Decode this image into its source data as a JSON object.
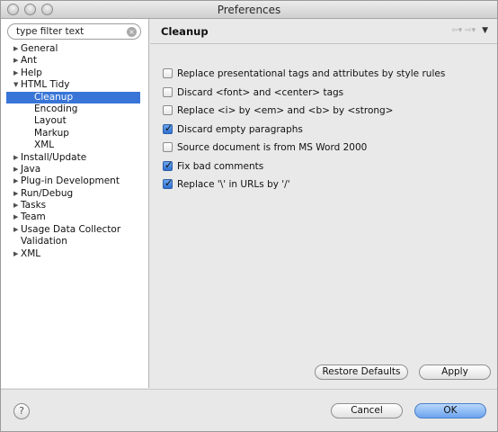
{
  "window": {
    "title": "Preferences"
  },
  "search": {
    "value": "type filter text"
  },
  "tree": [
    {
      "label": "General",
      "level": 0,
      "arrow": "▶"
    },
    {
      "label": "Ant",
      "level": 0,
      "arrow": "▶"
    },
    {
      "label": "Help",
      "level": 0,
      "arrow": "▶"
    },
    {
      "label": "HTML Tidy",
      "level": 0,
      "arrow": "▼"
    },
    {
      "label": "Cleanup",
      "level": 1,
      "selected": true
    },
    {
      "label": "Encoding",
      "level": 1
    },
    {
      "label": "Layout",
      "level": 1
    },
    {
      "label": "Markup",
      "level": 1
    },
    {
      "label": "XML",
      "level": 1
    },
    {
      "label": "Install/Update",
      "level": 0,
      "arrow": "▶"
    },
    {
      "label": "Java",
      "level": 0,
      "arrow": "▶"
    },
    {
      "label": "Plug-in Development",
      "level": 0,
      "arrow": "▶"
    },
    {
      "label": "Run/Debug",
      "level": 0,
      "arrow": "▶"
    },
    {
      "label": "Tasks",
      "level": 0,
      "arrow": "▶"
    },
    {
      "label": "Team",
      "level": 0,
      "arrow": "▶"
    },
    {
      "label": "Usage Data Collector",
      "level": 0,
      "arrow": "▶"
    },
    {
      "label": "Validation",
      "level": 0
    },
    {
      "label": "XML",
      "level": 0,
      "arrow": "▶"
    }
  ],
  "page": {
    "title": "Cleanup",
    "options": [
      {
        "label": "Replace presentational tags and attributes by style rules",
        "checked": false
      },
      {
        "label": "Discard <font> and <center> tags",
        "checked": false
      },
      {
        "label": "Replace <i> by <em> and <b> by <strong>",
        "checked": false
      },
      {
        "label": "Discard empty paragraphs",
        "checked": true
      },
      {
        "label": "Source document is from MS Word 2000",
        "checked": false
      },
      {
        "label": "Fix bad comments",
        "checked": true
      },
      {
        "label": "Replace '\\' in URLs by '/'",
        "checked": true
      }
    ],
    "restore_label": "Restore Defaults",
    "apply_label": "Apply"
  },
  "footer": {
    "help_label": "?",
    "cancel_label": "Cancel",
    "ok_label": "OK"
  }
}
